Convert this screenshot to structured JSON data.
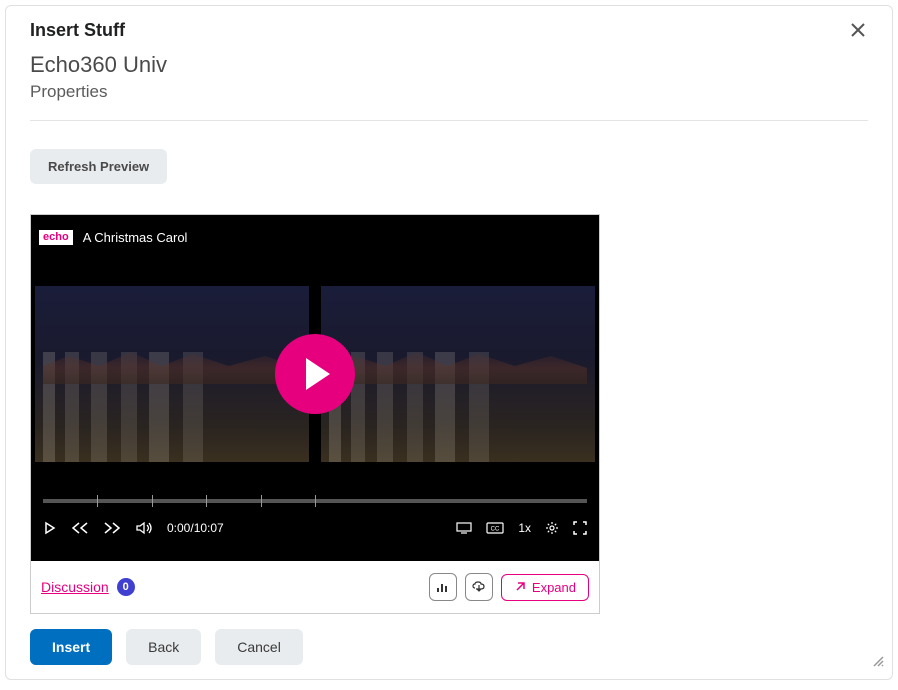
{
  "dialog": {
    "title": "Insert Stuff",
    "subtitle": "Echo360 Univ",
    "properties_label": "Properties"
  },
  "refresh_btn": "Refresh Preview",
  "video": {
    "logo_text": "echo",
    "title": "A Christmas Carol",
    "current_time": "0:00",
    "duration": "10:07",
    "speed": "1x"
  },
  "discussion": {
    "label": "Discussion",
    "count": "0"
  },
  "expand_label": "Expand",
  "footer": {
    "insert": "Insert",
    "back": "Back",
    "cancel": "Cancel"
  }
}
